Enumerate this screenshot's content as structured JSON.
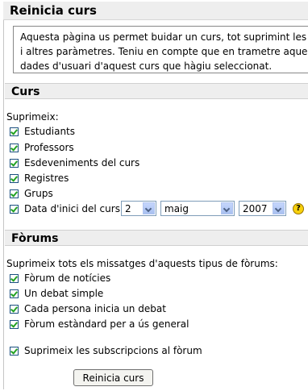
{
  "page": {
    "title": "Reinicia curs",
    "intro_lines": [
      "Aquesta pàgina us permet buidar un curs, tot suprimint les da",
      "i altres paràmetres. Teniu en compte que en trametre aquest f",
      "dades d'usuari d'aquest curs que hàgiu seleccionat."
    ]
  },
  "course_section": {
    "heading": "Curs",
    "delete_label": "Suprimeix:",
    "options": [
      {
        "label": "Estudiants",
        "checked": true
      },
      {
        "label": "Professors",
        "checked": true
      },
      {
        "label": "Esdeveniments del curs",
        "checked": true
      },
      {
        "label": "Registres",
        "checked": true
      },
      {
        "label": "Grups",
        "checked": true
      }
    ],
    "start_date": {
      "label": "Data d'inici del curs",
      "checked": true,
      "day": "2",
      "month": "maig",
      "year": "2007"
    },
    "help_icon": "help-icon"
  },
  "forums_section": {
    "heading": "Fòrums",
    "delete_label": "Suprimeix tots els missatges d'aquests tipus de fòrums:",
    "options": [
      {
        "label": "Fòrum de notícies",
        "checked": true
      },
      {
        "label": "Un debat simple",
        "checked": true
      },
      {
        "label": "Cada persona inicia un debat",
        "checked": true
      },
      {
        "label": "Fòrum estàndard per a ús general",
        "checked": true
      }
    ],
    "subscriptions": {
      "label": "Suprimeix les subscripcions al fòrum",
      "checked": true
    }
  },
  "submit": {
    "label": "Reinicia curs"
  },
  "colors": {
    "check": "#21a121",
    "header_bg": "#eeeeee",
    "help": "#f8d10c"
  }
}
